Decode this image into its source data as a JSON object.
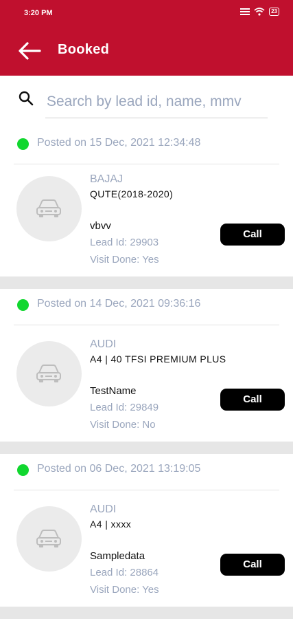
{
  "status_bar": {
    "time": "3:20 PM",
    "battery": "23"
  },
  "header": {
    "title": "Booked"
  },
  "search": {
    "placeholder": "Search by lead id, name, mmv"
  },
  "leads": [
    {
      "posted": "Posted on 15 Dec, 2021 12:34:48",
      "brand": "BAJAJ",
      "model": "QUTE(2018-2020)",
      "customer": "vbvv",
      "lead_id": "Lead Id: 29903",
      "visit": "Visit Done: Yes",
      "call_label": "Call"
    },
    {
      "posted": "Posted on 14 Dec, 2021 09:36:16",
      "brand": "AUDI",
      "model": "A4 | 40 TFSI PREMIUM PLUS",
      "customer": "TestName",
      "lead_id": "Lead Id: 29849",
      "visit": "Visit Done: No",
      "call_label": "Call"
    },
    {
      "posted": "Posted on 06 Dec, 2021 13:19:05",
      "brand": "AUDI",
      "model": "A4 | xxxx",
      "customer": "Sampledata",
      "lead_id": "Lead Id: 28864",
      "visit": "Visit Done: Yes",
      "call_label": "Call"
    }
  ],
  "icons": {
    "back": "arrow-left-icon",
    "search": "search-icon",
    "car": "car-icon"
  },
  "colors": {
    "app_bar": "#c0102e",
    "status_dot": "#11d72f",
    "call_button": "#000000",
    "muted_text": "#9aa6bd"
  }
}
